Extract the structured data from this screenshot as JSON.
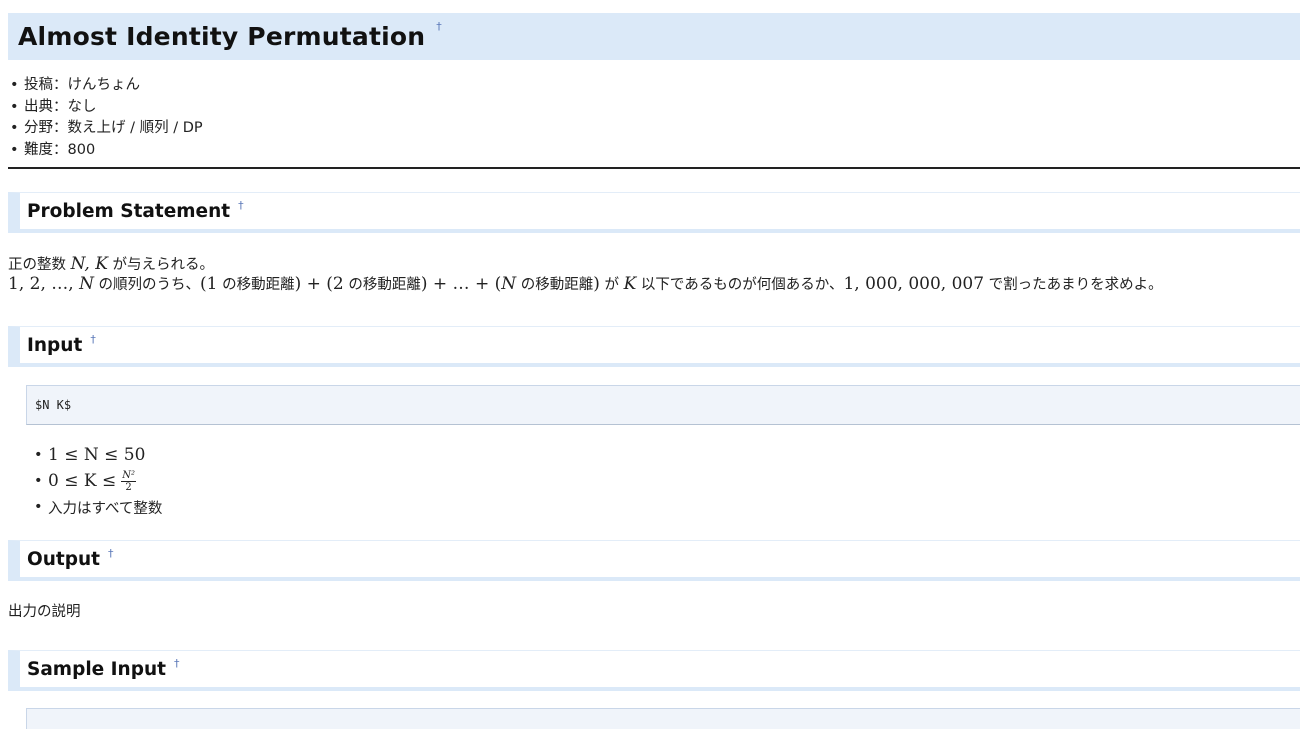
{
  "title": "Almost Identity Permutation",
  "anchor_mark": "†",
  "meta": [
    "投稿：けんちょん",
    "出典：なし",
    "分野：数え上げ / 順列 / DP",
    "難度：800"
  ],
  "sections": {
    "problem": {
      "heading": "Problem Statement",
      "line1": {
        "t1": "正の整数 ",
        "m1": "N, K",
        "t2": " が与えられる。"
      },
      "line2": {
        "m1": "1, 2, …, ",
        "m1i": "N",
        "t1": " の順列のうち、",
        "m2": "(1",
        "t2": " の移動距離",
        "m3": ") + (2",
        "t3": " の移動距離",
        "m4": ") + … + (",
        "m4i": "N",
        "t4": " の移動距離",
        "m5": ")",
        "t5": " が ",
        "m6": "K",
        "t6": " 以下であるものが何個あるか、",
        "m7": "1, 000, 000, 007",
        "t7": " で割ったあまりを求めよ。"
      }
    },
    "input": {
      "heading": "Input",
      "format": "$N K$",
      "constraints": {
        "c1": "1 ≤ N ≤ 50",
        "c2_prefix": "0 ≤ K ≤",
        "c2_num": "N²",
        "c2_den": "2",
        "c3": "入力はすべて整数"
      }
    },
    "output": {
      "heading": "Output",
      "text": "出力の説明"
    },
    "sample_input": {
      "heading": "Sample Input"
    }
  }
}
